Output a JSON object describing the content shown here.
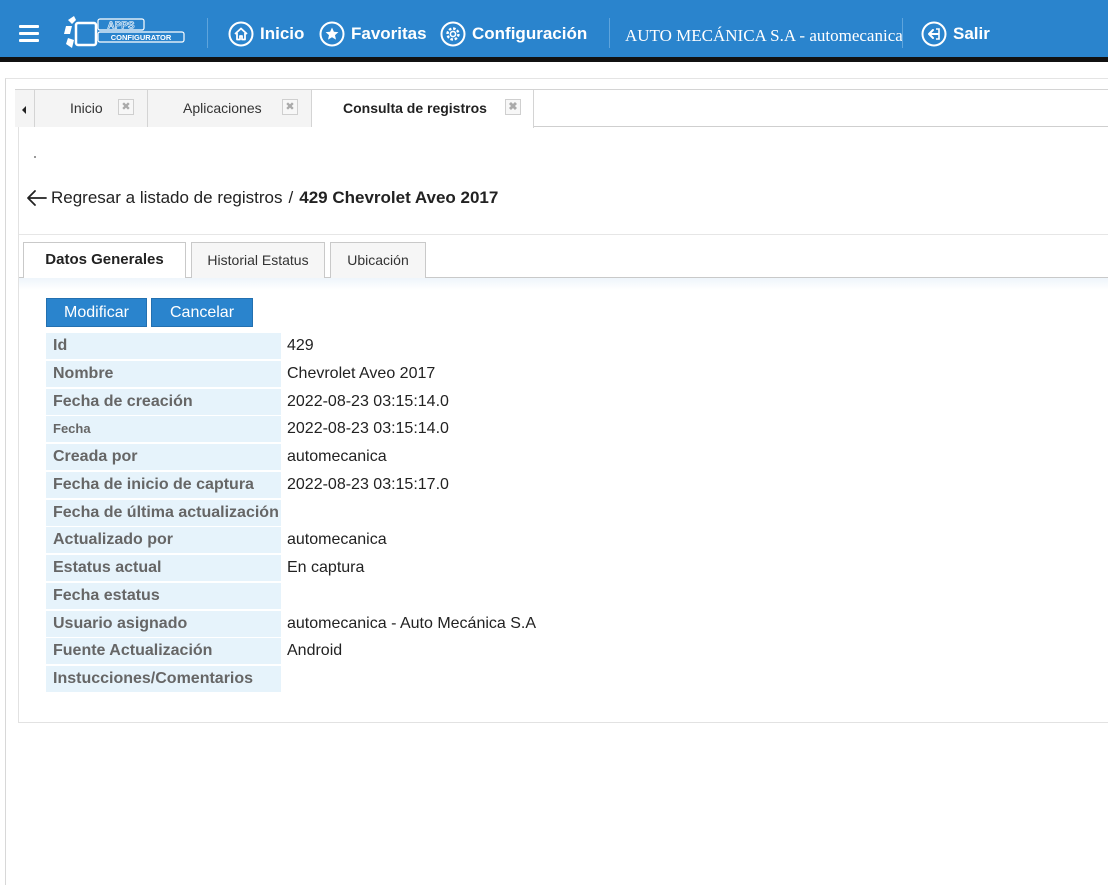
{
  "header": {
    "logo_text": "APPS CONFIGURATOR",
    "nav": [
      {
        "label": "Inicio",
        "icon": "home-icon"
      },
      {
        "label": "Favoritas",
        "icon": "star-icon"
      },
      {
        "label": "Configuración",
        "icon": "gear-icon"
      }
    ],
    "company": "AUTO MECÁNICA S.A - automecanica",
    "logout_label": "Salir",
    "bar_color": "#2a84cd"
  },
  "tabs": [
    {
      "label": "Inicio",
      "active": false
    },
    {
      "label": "Aplicaciones",
      "active": false
    },
    {
      "label": "Consulta de registros",
      "active": true
    }
  ],
  "breadcrumb": {
    "back_label": "Regresar a listado de registros",
    "separator": "/",
    "current": "429 Chevrolet Aveo 2017"
  },
  "subtabs": [
    {
      "label": "Datos Generales",
      "active": true
    },
    {
      "label": "Historial Estatus",
      "active": false
    },
    {
      "label": "Ubicación",
      "active": false
    }
  ],
  "buttons": {
    "modify": "Modificar",
    "cancel": "Cancelar"
  },
  "fields": [
    {
      "label": "Id",
      "value": "429"
    },
    {
      "label": "Nombre",
      "value": "Chevrolet Aveo 2017"
    },
    {
      "label": "Fecha de creación",
      "value": "2022-08-23 03:15:14.0"
    },
    {
      "label": "Fecha",
      "value": "2022-08-23 03:15:14.0"
    },
    {
      "label": "Creada por",
      "value": "automecanica"
    },
    {
      "label": "Fecha de inicio de captura",
      "value": "2022-08-23 03:15:17.0"
    },
    {
      "label": "Fecha de última actualización",
      "value": ""
    },
    {
      "label": "Actualizado por",
      "value": "automecanica"
    },
    {
      "label": "Estatus actual",
      "value": "En captura"
    },
    {
      "label": "Fecha estatus",
      "value": ""
    },
    {
      "label": "Usuario asignado",
      "value": "automecanica - Auto Mecánica S.A"
    },
    {
      "label": "Fuente Actualización",
      "value": "Android"
    },
    {
      "label": "Instucciones/Comentarios",
      "value": ""
    }
  ]
}
